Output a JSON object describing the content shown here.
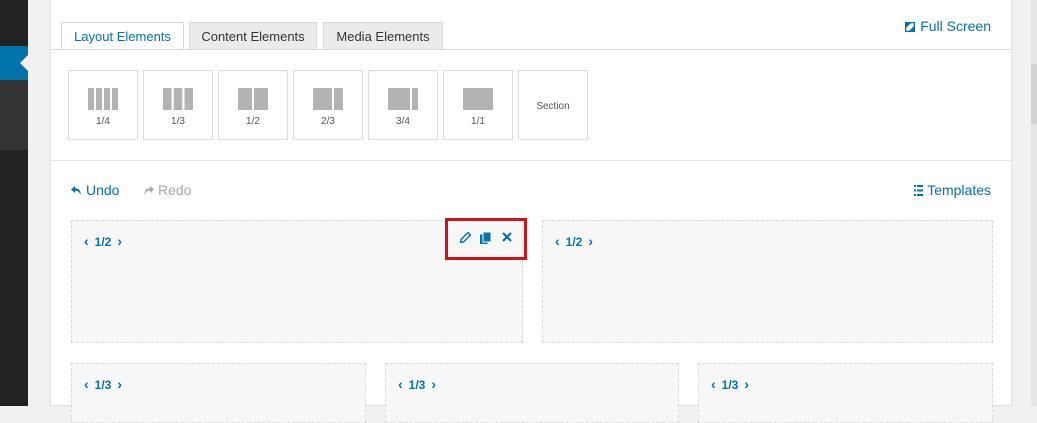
{
  "tabs": [
    {
      "label": "Layout Elements"
    },
    {
      "label": "Content Elements"
    },
    {
      "label": "Media Elements"
    }
  ],
  "fullscreen": {
    "label": "Full Screen"
  },
  "elements": [
    {
      "label": "1/4",
      "icon": "four-columns-icon"
    },
    {
      "label": "1/3",
      "icon": "three-columns-icon"
    },
    {
      "label": "1/2",
      "icon": "two-columns-icon"
    },
    {
      "label": "2/3",
      "icon": "two-thirds-icon"
    },
    {
      "label": "3/4",
      "icon": "three-quarters-icon"
    },
    {
      "label": "1/1",
      "icon": "full-width-icon"
    },
    {
      "label": "Section"
    }
  ],
  "toolbar": {
    "undo": "Undo",
    "redo": "Redo",
    "templates": "Templates"
  },
  "rows": [
    {
      "columns": [
        {
          "size": "1/2"
        },
        {
          "size": "1/2"
        }
      ]
    },
    {
      "columns": [
        {
          "size": "1/3"
        },
        {
          "size": "1/3"
        },
        {
          "size": "1/3"
        }
      ]
    }
  ],
  "colors": {
    "accent": "#0073aa",
    "highlight": "#c9161c",
    "sidebar": "#222222"
  }
}
